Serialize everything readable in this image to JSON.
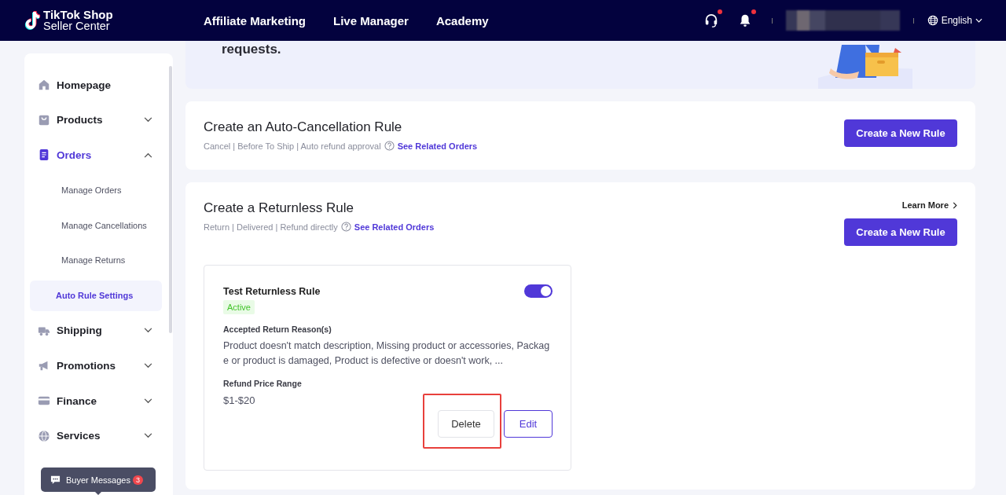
{
  "header": {
    "logo_line_1": "TikTok Shop",
    "logo_line_2": "Seller Center",
    "nav": [
      "Affiliate Marketing",
      "Live Manager",
      "Academy"
    ],
    "support_unread": true,
    "notifications_unread": true,
    "language": "English"
  },
  "banner": {
    "text": "requests."
  },
  "sidebar": {
    "items": [
      {
        "label": "Homepage",
        "selected": false
      },
      {
        "label": "Products",
        "selected": false,
        "expanded": false
      },
      {
        "label": "Orders",
        "selected": true,
        "expanded": true,
        "children": [
          {
            "label": "Manage Orders",
            "selected": false
          },
          {
            "label": "Manage Cancellations",
            "selected": false
          },
          {
            "label": "Manage Returns",
            "selected": false
          },
          {
            "label": "Auto Rule Settings",
            "selected": true
          }
        ]
      },
      {
        "label": "Shipping",
        "selected": false,
        "expanded": false
      },
      {
        "label": "Promotions",
        "selected": false,
        "expanded": false
      },
      {
        "label": "Finance",
        "selected": false,
        "expanded": false
      },
      {
        "label": "Services",
        "selected": false,
        "expanded": false
      }
    ]
  },
  "sections": [
    {
      "title": "Create an Auto-Cancellation Rule",
      "subtitle": "Cancel | Before To Ship | Auto refund approval",
      "link": "See Related Orders",
      "button": "Create a New Rule"
    },
    {
      "title": "Create a Returnless Rule",
      "subtitle": "Return | Delivered | Refund directly",
      "link": "See Related Orders",
      "button": "Create a New Rule",
      "learn_more": "Learn More",
      "rules": [
        {
          "name": "Test Returnless Rule",
          "on": true,
          "status": "Active",
          "reasons_label": "Accepted Return Reason(s)",
          "reasons": "Product doesn't match description, Missing product or accessories, Package or product is damaged, Product is defective or doesn't work, ...",
          "price_label": "Refund Price Range",
          "price": "$1-$20",
          "delete_button": "Delete",
          "edit_button": "Edit",
          "delete_highlighted": true
        }
      ]
    }
  ],
  "chat": {
    "label": "Buyer Messages",
    "count": "3"
  }
}
